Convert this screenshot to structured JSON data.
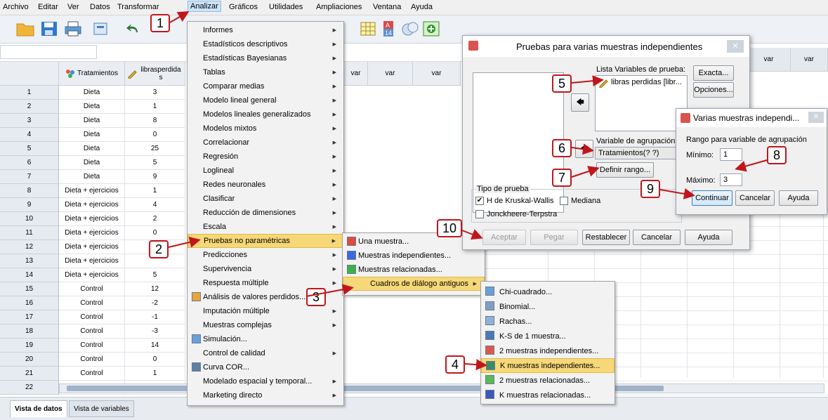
{
  "menubar": [
    "Archivo",
    "Editar",
    "Ver",
    "Datos",
    "Transformar",
    "Analizar",
    "Gráficos",
    "Utilidades",
    "Ampliaciones",
    "Ventana",
    "Ayuda"
  ],
  "grid": {
    "col_tratamientos": "Tratamientos",
    "col_libras": "librasperdida s",
    "var_header": "var",
    "rows": [
      [
        "1",
        "Dieta",
        "3"
      ],
      [
        "2",
        "Dieta",
        "1"
      ],
      [
        "3",
        "Dieta",
        "8"
      ],
      [
        "4",
        "Dieta",
        "0"
      ],
      [
        "5",
        "Dieta",
        "25"
      ],
      [
        "6",
        "Dieta",
        "5"
      ],
      [
        "7",
        "Dieta",
        "9"
      ],
      [
        "8",
        "Dieta + ejercicios",
        "1"
      ],
      [
        "9",
        "Dieta + ejercicios",
        "4"
      ],
      [
        "10",
        "Dieta + ejercicios",
        "2"
      ],
      [
        "11",
        "Dieta + ejercicios",
        "0"
      ],
      [
        "12",
        "Dieta + ejercicios",
        ""
      ],
      [
        "13",
        "Dieta + ejercicios",
        ""
      ],
      [
        "14",
        "Dieta + ejercicios",
        "5"
      ],
      [
        "15",
        "Control",
        "12"
      ],
      [
        "16",
        "Control",
        "-2"
      ],
      [
        "17",
        "Control",
        "-1"
      ],
      [
        "18",
        "Control",
        "-3"
      ],
      [
        "19",
        "Control",
        "14"
      ],
      [
        "20",
        "Control",
        "0"
      ],
      [
        "21",
        "Control",
        "1"
      ],
      [
        "22",
        "",
        ""
      ]
    ]
  },
  "tabs": {
    "data_view": "Vista de datos",
    "variable_view": "Vista de variables"
  },
  "analizar_menu": [
    "Informes",
    "Estadísticos descriptivos",
    "Estadísticas Bayesianas",
    "Tablas",
    "Comparar medias",
    "Modelo lineal general",
    "Modelos lineales generalizados",
    "Modelos mixtos",
    "Correlacionar",
    "Regresión",
    "Loglineal",
    "Redes neuronales",
    "Clasificar",
    "Reducción de dimensiones",
    "Escala",
    "Pruebas no paramétricas",
    "Predicciones",
    "Supervivencia",
    "Respuesta múltiple",
    "Análisis de valores perdidos...",
    "Imputación múltiple",
    "Muestras complejas",
    "Simulación...",
    "Control de calidad",
    "Curva COR...",
    "Modelado espacial y temporal...",
    "Marketing directo"
  ],
  "nonparam_menu": [
    "Una muestra...",
    "Muestras independientes...",
    "Muestras relacionadas...",
    "Cuadros de diálogo antiguos"
  ],
  "legacy_menu": [
    "Chi-cuadrado...",
    "Binomial...",
    "Rachas...",
    "K-S de 1 muestra...",
    "2 muestras independientes...",
    "K muestras independientes...",
    "2 muestras relacionadas...",
    "K muestras relacionadas..."
  ],
  "dialog_main": {
    "title": "Pruebas para varias muestras independientes",
    "test_list_label": "Lista Variables de prueba:",
    "test_var": "libras perdidas [libr...",
    "group_label": "Variable de agrupación:",
    "group_value": "Tratamientos(? ?)",
    "define_range": "Definir rango...",
    "exact": "Exacta...",
    "options": "Opciones...",
    "test_type_label": "Tipo de prueba",
    "kruskal": "H de Kruskal-Wallis",
    "median": "Mediana",
    "jonckheere": "Jonckheere-Terpstra",
    "accept": "Aceptar",
    "paste": "Pegar",
    "reset": "Restablecer",
    "cancel": "Cancelar",
    "help": "Ayuda"
  },
  "dialog_range": {
    "title": "Varias muestras independi...",
    "range_label": "Rango para variable de agrupación",
    "min_label": "Mínimo:",
    "min_value": "1",
    "max_label": "Máximo:",
    "max_value": "3",
    "continue": "Continuar",
    "cancel": "Cancelar",
    "help": "Ayuda"
  },
  "callouts": [
    "1",
    "2",
    "3",
    "4",
    "5",
    "6",
    "7",
    "8",
    "9",
    "10"
  ],
  "colors": {
    "callout_border": "#c0161b",
    "menu_highlight": "#f6d878",
    "grid_header": "#eaeef3"
  }
}
